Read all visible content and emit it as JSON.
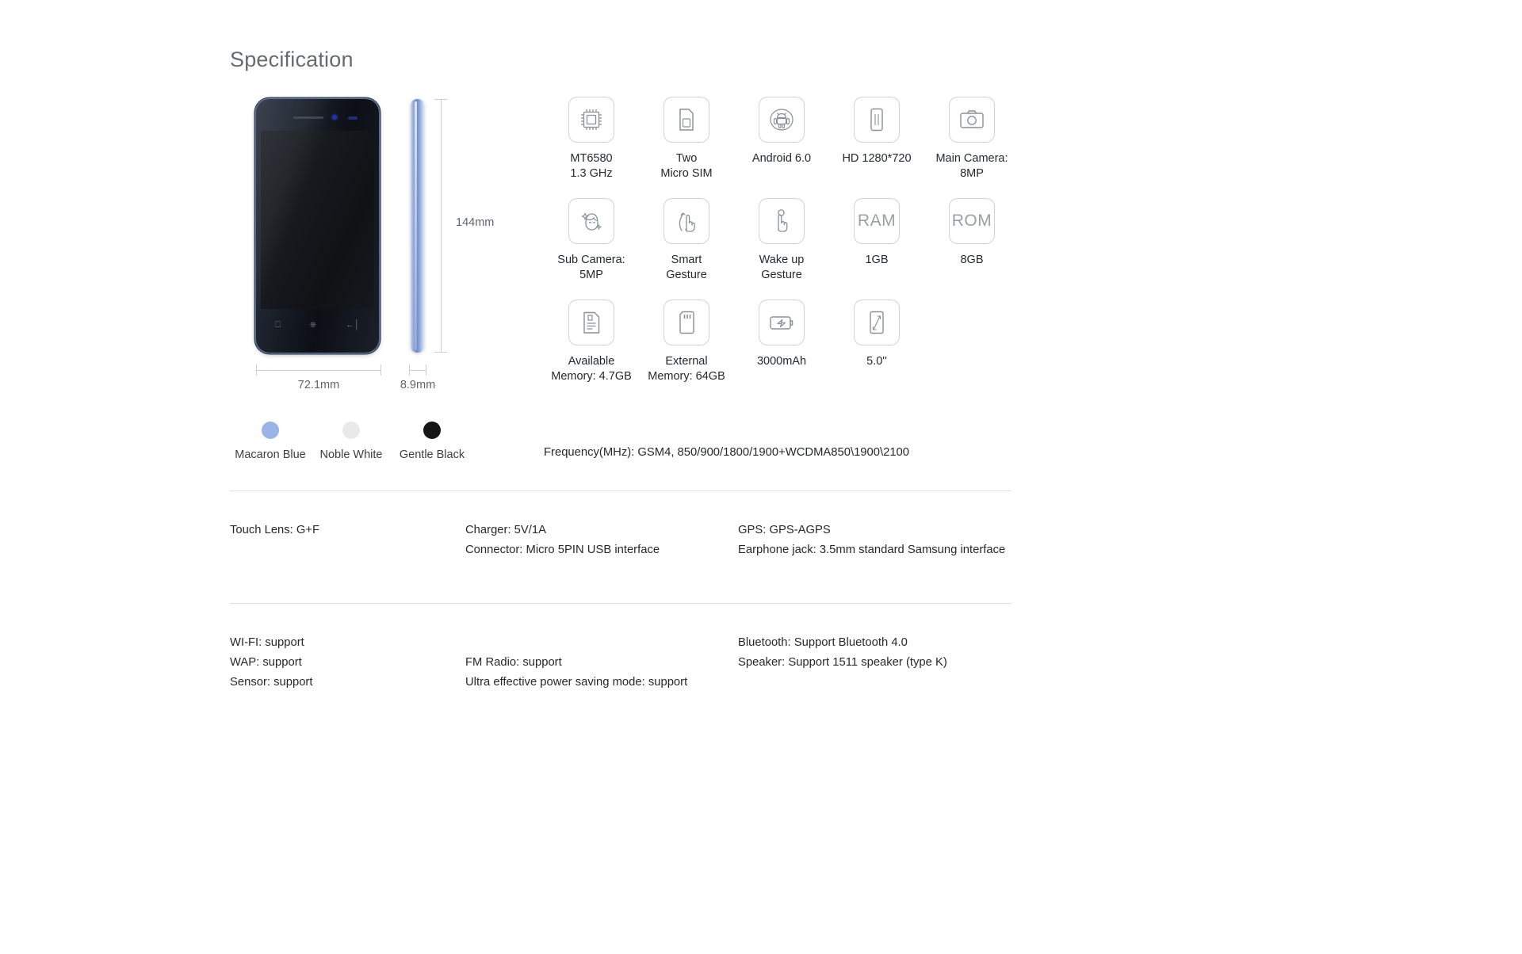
{
  "title": "Specification",
  "device": {
    "front_view_alt": "phone-front-view",
    "side_view_alt": "phone-side-view",
    "dimensions": {
      "height": "144mm",
      "width": "72.1mm",
      "thickness": "8.9mm"
    }
  },
  "colors": [
    {
      "name": "Macaron Blue",
      "hex": "#9bb4e8"
    },
    {
      "name": "Noble White",
      "hex": "#e9e9eb"
    },
    {
      "name": "Gentle Black",
      "hex": "#161616"
    }
  ],
  "features": [
    [
      {
        "icon": "cpu-chip-icon",
        "line1": "MT6580",
        "line2": "1.3 GHz"
      },
      {
        "icon": "sim-card-icon",
        "line1": "Two",
        "line2": "Micro SIM"
      },
      {
        "icon": "android-robot-icon",
        "line1": "Android 6.0",
        "line2": ""
      },
      {
        "icon": "screen-resolution-icon",
        "line1": "HD 1280*720",
        "line2": ""
      },
      {
        "icon": "camera-icon",
        "line1": "Main Camera:",
        "line2": "8MP"
      }
    ],
    [
      {
        "icon": "selfie-beauty-icon",
        "line1": "Sub Camera:",
        "line2": "5MP"
      },
      {
        "icon": "swipe-gesture-icon",
        "line1": "Smart",
        "line2": "Gesture"
      },
      {
        "icon": "tap-gesture-icon",
        "line1": "Wake up",
        "line2": "Gesture"
      },
      {
        "icon": "ram-text-icon",
        "icon_text": "RAM",
        "line1": "1GB",
        "line2": ""
      },
      {
        "icon": "rom-text-icon",
        "icon_text": "ROM",
        "line1": "8GB",
        "line2": ""
      }
    ],
    [
      {
        "icon": "document-memory-icon",
        "line1": "Available",
        "line2": "Memory: 4.7GB"
      },
      {
        "icon": "microsd-card-icon",
        "line1": "External",
        "line2": "Memory: 64GB"
      },
      {
        "icon": "battery-icon",
        "line1": "3000mAh",
        "line2": ""
      },
      {
        "icon": "screen-size-icon",
        "line1": "5.0''",
        "line2": ""
      }
    ]
  ],
  "frequency": "Frequency(MHz): GSM4, 850/900/1800/1900+WCDMA850\\1900\\2100",
  "specs_mid": {
    "col1": [
      "Touch Lens: G+F"
    ],
    "col2": [
      "Charger: 5V/1A",
      "Connector: Micro 5PIN USB interface"
    ],
    "col3": [
      "GPS: GPS-AGPS",
      "Earphone jack: 3.5mm standard Samsung interface"
    ]
  },
  "specs_bottom": {
    "col1": [
      "WI-FI: support",
      "WAP: support",
      "Sensor: support"
    ],
    "col2": [
      "",
      "FM Radio: support",
      "Ultra effective power saving mode: support"
    ],
    "col3": [
      "Bluetooth: Support Bluetooth 4.0",
      "Speaker: Support 1511 speaker (type K)",
      ""
    ]
  }
}
